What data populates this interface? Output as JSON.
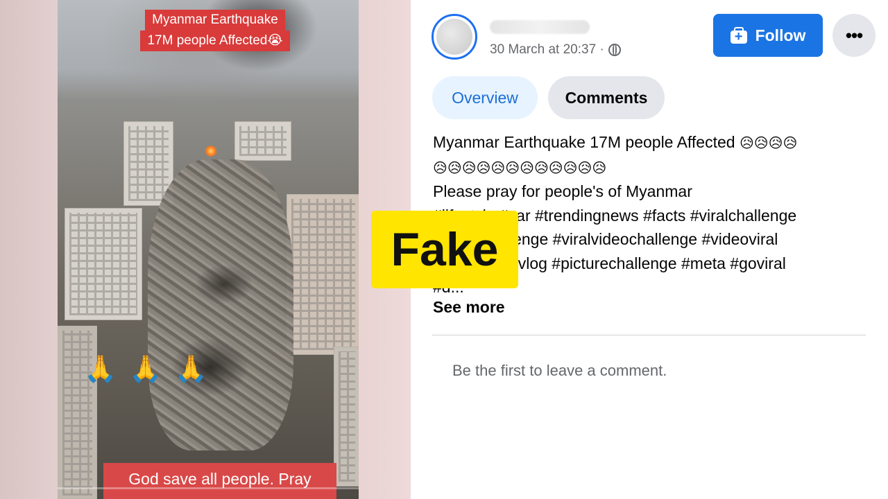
{
  "video": {
    "caption_top_line1": "Myanmar Earthquake",
    "caption_top_line2": "17M people Affected😭",
    "praying_emojis": "🙏🙏🙏",
    "caption_bottom": "God save all people. Pray"
  },
  "post": {
    "timestamp": "30 March at 20:37 ·",
    "follow_label": "Follow",
    "more_label": "•••",
    "tabs": [
      {
        "label": "Overview",
        "active": true
      },
      {
        "label": "Comments",
        "active": false
      }
    ],
    "text_line1": "Myanmar Earthquake 17M people Affected ",
    "emoji_line1": "😥😥😥😥",
    "emoji_line2": "😥😥😥😥😥😥😥😥😥😥😥😥",
    "text_line3": "Please pray for people's of Myanmar",
    "hashtags_line1": "#lifestyle #car #trendingnews #facts #viralchallenge",
    "hashtags_line2": "#videochallenge #viralvideochallenge #videoviral",
    "hashtags_line3": "#followers #vlog #picturechallenge #meta #goviral",
    "hashtags_line4": "#d...",
    "see_more_label": "See more",
    "empty_comments_text": "Be the first to leave a comment."
  },
  "stamp": {
    "label": "Fake",
    "color": "#ffe500"
  },
  "colors": {
    "facebook_blue": "#1b74e4",
    "caption_red": "#d93a3a"
  }
}
